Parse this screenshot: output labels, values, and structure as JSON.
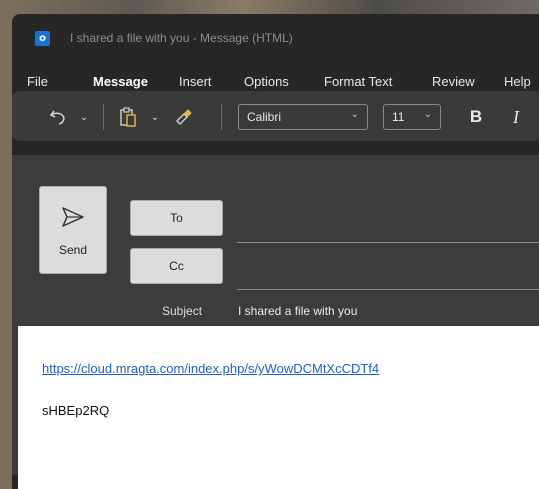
{
  "window": {
    "title": "I shared a file with you  -  Message (HTML)",
    "app_icon_letter": "o"
  },
  "menu": {
    "items": [
      "File",
      "Message",
      "Insert",
      "Options",
      "Format Text",
      "Review",
      "Help"
    ],
    "active": "Message"
  },
  "ribbon": {
    "font_name": "Calibri",
    "font_size": "11",
    "bold_label": "B",
    "italic_label": "I",
    "icons": [
      "undo-icon",
      "paste-icon",
      "format-painter-icon"
    ]
  },
  "compose": {
    "send_label": "Send",
    "to_label": "To",
    "cc_label": "Cc",
    "subject_label": "Subject",
    "subject_value": "I shared a file with you",
    "to_value": "",
    "cc_value": ""
  },
  "body": {
    "link": "https://cloud.mragta.com/index.php/s/yWowDCMtXcCDTf4",
    "text": "sHBEp2RQ"
  },
  "colors": {
    "window_bg": "#272727",
    "ribbon_bg": "#3a3a3a",
    "compose_bg": "#3c3c3c",
    "link": "#1a5fd6",
    "app_icon": "#1a73d6"
  }
}
